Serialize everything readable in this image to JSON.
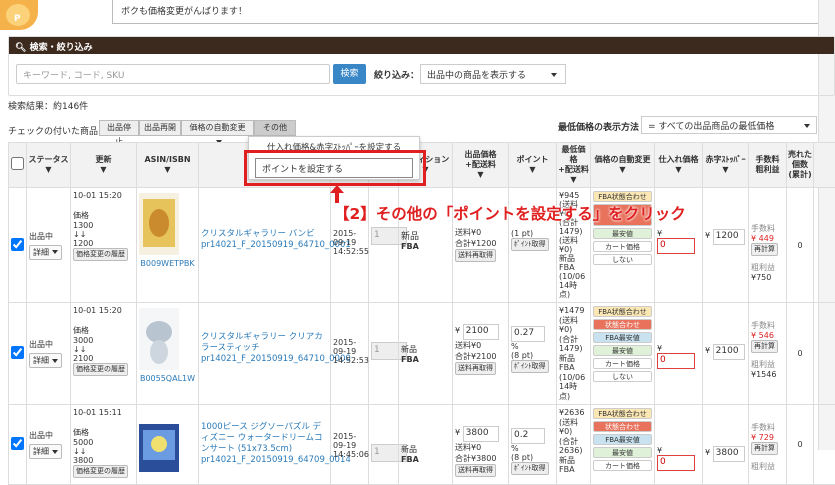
{
  "speech": {
    "text": "ボクも価格変更がんばります！"
  },
  "search": {
    "header": "検索・絞り込み",
    "placeholder": "キーワード, コード, SKU",
    "button": "検索",
    "filter_label": "絞り込み：",
    "filter_value": "出品中の商品を表示する"
  },
  "results": {
    "text": "検索結果：約146件"
  },
  "bulk": {
    "label": "チェックの付いた商品を",
    "stop": "出品停止",
    "resume": "出品再開",
    "auto": "価格の自動変更",
    "other": "その他"
  },
  "min_price": {
    "label": "最低価格の表示方法",
    "value": "= すべての出品商品の最低価格"
  },
  "dropdown": {
    "item1": "仕入れ価格&赤字ｽﾄｯﾊﾟｰを設定する",
    "item2": "ポイントを設定する"
  },
  "callout": "【2】その他の「ポイントを設定する」をクリック",
  "headers": {
    "status": "ステータス",
    "updated": "更新",
    "asin": "ASIN/ISBN",
    "product": "商",
    "condition": "ンディション",
    "price": "出品価格\n+配送料",
    "point": "ポイント",
    "min": "最低価格\n+配送料",
    "strategy": "価格の自動変更",
    "cost": "仕入れ価格",
    "stopper": "赤字ｽﾄｯﾊﾟｰ",
    "fee": "手数料\n粗利益",
    "sold": "売れた個数(累計)"
  },
  "rows": [
    {
      "status": "出品中",
      "detail": "詳細",
      "updated": "10-01 15:20",
      "price_label": "価格",
      "old_price": "1300",
      "arrow": "↓↓",
      "new_price": "1200",
      "history": "価格変更の履歴",
      "asin": "B009WETPBK",
      "title": "クリスタルギャラリー バンビ",
      "sku": "pr14021_F_20150919_64710_0001",
      "date": "2015-09-19 14:52:55",
      "qty": "1",
      "condition": "新品",
      "channel": "FBA",
      "price_line1": "送料¥0",
      "price_line2": "合計¥1200",
      "price_btn": "送料再取得",
      "point_pt": "(1 pt)",
      "point_btn": "ﾎﾟｲﾝﾄ取得",
      "min_lines": [
        "¥945",
        "(送料¥0)",
        "(合計",
        "1479)",
        "(送料",
        "¥0)",
        "新品",
        "FBA",
        "(10/06",
        "14時点)"
      ],
      "strategy": [
        "FBA状態合わせ",
        "",
        "最安値",
        "カート価格",
        "しない"
      ],
      "cost": "0",
      "stopper": "1200",
      "fee_label": "手数料",
      "fee": "¥ 449",
      "recalc": "再計算",
      "profit_label": "粗利益",
      "profit": "¥750",
      "sold": "0"
    },
    {
      "status": "出品中",
      "detail": "詳細",
      "updated": "10-01 15:20",
      "price_label": "価格",
      "old_price": "3000",
      "arrow": "↓↓",
      "new_price": "2100",
      "history": "価格変更の履歴",
      "asin": "B0055QAL1W",
      "title": "クリスタルギャラリー クリアカラースティッチ",
      "sku": "pr14021_F_20150919_64710_0000",
      "date": "2015-09-19 14:52:53",
      "qty": "1",
      "condition": "新品",
      "channel": "FBA",
      "price_value": "2100",
      "price_line1": "送料¥0",
      "price_line2": "合計¥2100",
      "price_btn": "送料再取得",
      "point_value": "0.27",
      "point_pt": "(8 pt)",
      "point_btn": "ﾎﾟｲﾝﾄ取得",
      "min_lines": [
        "¥1479",
        "(送料¥0)",
        "(合計",
        "1479)",
        "新品",
        "FBA",
        "(10/06",
        "14時点)"
      ],
      "strategy": [
        "FBA状態合わせ",
        "状態合わせ",
        "FBA最安値",
        "最安値",
        "カート価格",
        "しない"
      ],
      "cost": "0",
      "stopper": "2100",
      "fee_label": "手数料",
      "fee": "¥ 546",
      "recalc": "再計算",
      "profit_label": "粗利益",
      "profit": "¥1546",
      "sold": "0"
    },
    {
      "status": "出品中",
      "detail": "詳細",
      "updated": "10-01 15:11",
      "price_label": "価格",
      "old_price": "5000",
      "arrow": "↓↓",
      "new_price": "3800",
      "history": "価格変更の履歴",
      "asin": "",
      "title": "1000ピース ジグソーパズル ディズニー ウォータードリームコンサート (51x73.5cm)",
      "sku": "pr14021_F_20150919_64709_0014",
      "date": "2015-09-19 14:45:06",
      "qty": "1",
      "condition": "新品",
      "channel": "FBA",
      "price_value": "3800",
      "price_line1": "送料¥0",
      "price_line2": "合計¥3800",
      "price_btn": "送料再取得",
      "point_value": "0.2",
      "point_pt": "(8 pt)",
      "point_btn": "ﾎﾟｲﾝﾄ取得",
      "min_lines": [
        "¥2636",
        "(送料¥0)",
        "(合計",
        "2636)",
        "新品",
        "FBA"
      ],
      "strategy": [
        "FBA状態合わせ",
        "状態合わせ",
        "FBA最安値",
        "最安値",
        "カート価格"
      ],
      "cost": "0",
      "stopper": "3800",
      "fee_label": "手数料",
      "fee": "¥ 729",
      "recalc": "再計算",
      "profit_label": "粗利益",
      "profit": "",
      "sold": "0"
    }
  ]
}
